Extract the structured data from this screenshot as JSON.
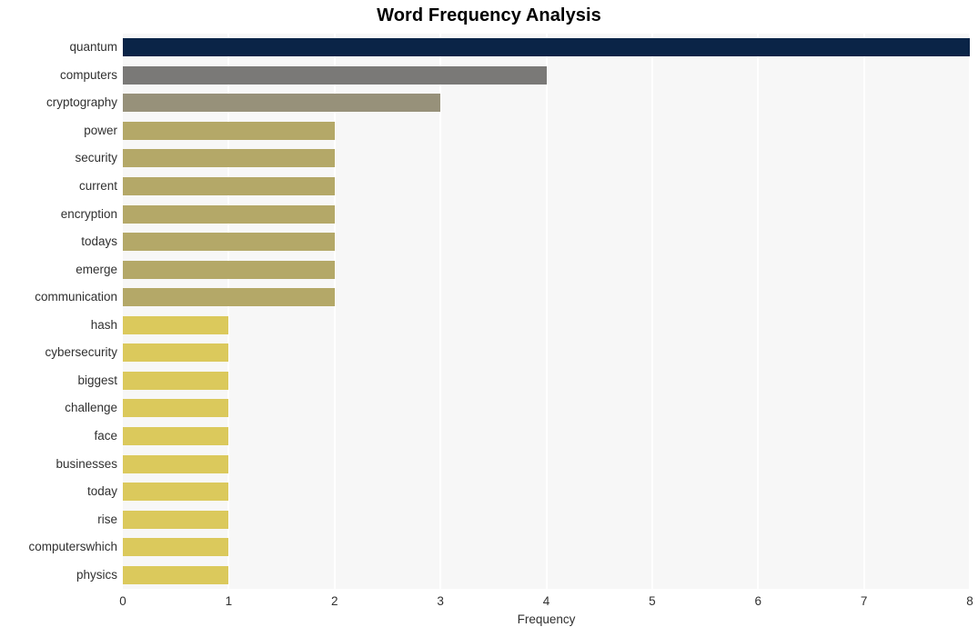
{
  "chart_data": {
    "type": "bar",
    "orientation": "horizontal",
    "title": "Word Frequency Analysis",
    "xlabel": "Frequency",
    "ylabel": "",
    "xlim": [
      0,
      8
    ],
    "xticks": [
      0,
      1,
      2,
      3,
      4,
      5,
      6,
      7,
      8
    ],
    "xtick_labels": [
      "0",
      "1",
      "2",
      "3",
      "4",
      "5",
      "6",
      "7",
      "8"
    ],
    "grid": "vertical",
    "legend": "none",
    "plot_background": "#f7f7f7",
    "gridline_color": "#ffffff",
    "categories": [
      "quantum",
      "computers",
      "cryptography",
      "power",
      "security",
      "current",
      "encryption",
      "todays",
      "emerge",
      "communication",
      "hash",
      "cybersecurity",
      "biggest",
      "challenge",
      "face",
      "businesses",
      "today",
      "rise",
      "computerswhich",
      "physics"
    ],
    "values": [
      8,
      4,
      3,
      2,
      2,
      2,
      2,
      2,
      2,
      2,
      1,
      1,
      1,
      1,
      1,
      1,
      1,
      1,
      1,
      1
    ],
    "bar_colors": [
      "#0a2447",
      "#7a7977",
      "#97917a",
      "#b4a868",
      "#b4a868",
      "#b4a868",
      "#b4a868",
      "#b4a868",
      "#b4a868",
      "#b4a868",
      "#dbc95c",
      "#dbc95c",
      "#dbc95c",
      "#dbc95c",
      "#dbc95c",
      "#dbc95c",
      "#dbc95c",
      "#dbc95c",
      "#dbc95c",
      "#dbc95c"
    ]
  }
}
